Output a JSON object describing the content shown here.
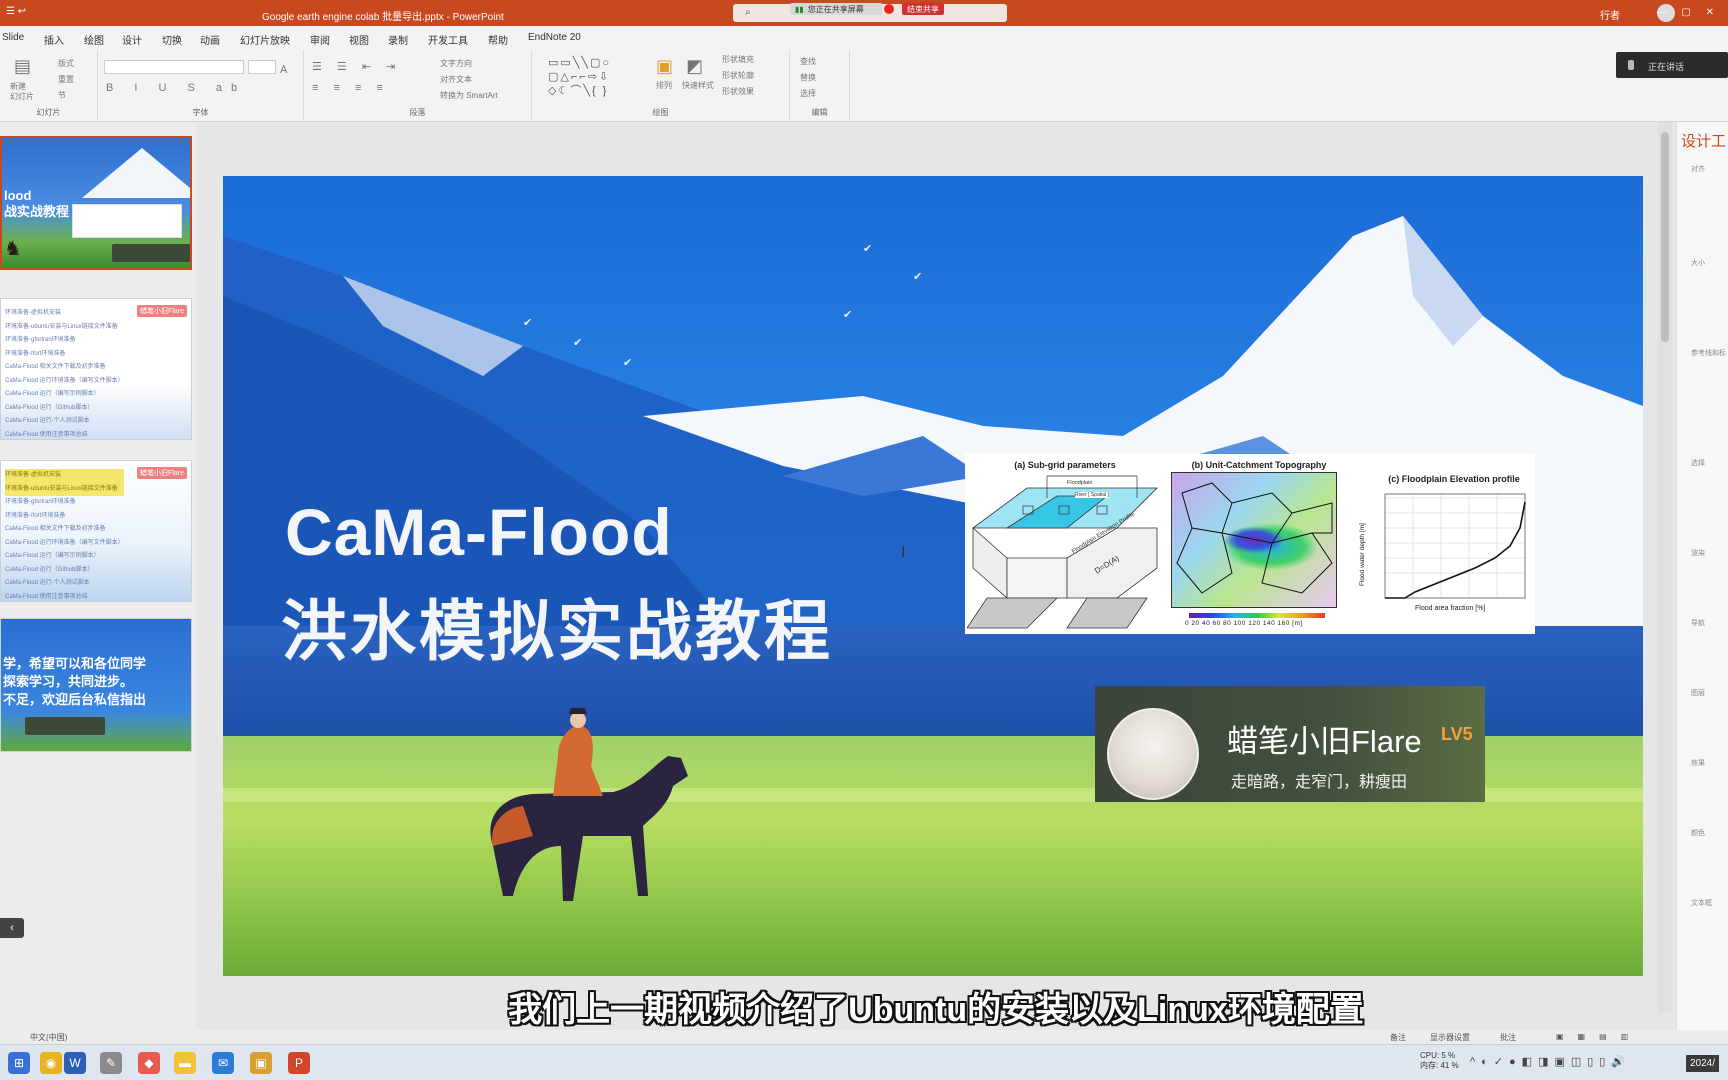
{
  "titlebar": {
    "file_title": "Google earth engine colab 批量导出.pptx  -  PowerPoint",
    "search_placeholder": "搜",
    "sharing_label": "您正在共享屏幕",
    "stop_share_label": "结束共享",
    "user_name": "行者",
    "window_controls": "— ▢ ✕"
  },
  "menubar": {
    "items": [
      "Slide",
      "插入",
      "绘图",
      "设计",
      "切换",
      "动画",
      "幻灯片放映",
      "审阅",
      "视图",
      "录制",
      "开发工具",
      "帮助",
      "EndNote 20"
    ]
  },
  "ribbon": {
    "groups": [
      "幻灯片",
      "字体",
      "段落",
      "绘图",
      "编辑"
    ],
    "new_slide": "新建\n幻灯片",
    "layout": "版式",
    "reset": "重置",
    "section": "节",
    "find": "查找",
    "replace": "替换",
    "select": "选择",
    "arrange": "排列",
    "quick_styles": "快速样式",
    "shape_fill": "形状填充",
    "shape_outline": "形状轮廓",
    "shape_effect": "形状效果",
    "text_direction": "文字方向",
    "align_text": "对齐文本",
    "smartart": "转换为 SmartArt",
    "present_label": "正在讲话"
  },
  "thumbnails": {
    "slide1_title": "lood\n战实战教程",
    "slide2_badge": "蜡笔小旧Flare",
    "slide2_lines": [
      "环境准备-虚拟机安装",
      "环境准备-ubuntu安装与Linux链接文件准备",
      "环境准备-gfortran环境准备",
      "环境准备-Ifort环境准备",
      "CaMa-Flood 相关文件下载及初步准备",
      "CaMa-Flood 运行环境准备（编写文件脚本）",
      "CaMa-Flood 运行（编写示例脚本）",
      "CaMa-Flood 运行（Github脚本）",
      "CaMa-Flood 运行-个人测试脚本",
      "CaMa-Flood 使用注意事项总结"
    ],
    "slide3_lines": [
      "环境准备-虚拟机安装",
      "环境准备-ubuntu安装与Linux链接文件准备",
      "环境准备-gfortran环境准备",
      "环境准备-Ifort环境准备",
      "CaMa-Flood 相关文件下载及初步准备",
      "CaMa-Flood 运行环境准备（编写文件脚本）",
      "CaMa-Flood 运行（编写示例脚本）",
      "CaMa-Flood 运行（Github脚本）",
      "CaMa-Flood 运行-个人测试脚本",
      "CaMa-Flood 使用注意事项总结"
    ],
    "slide4_text": "学，希望可以和各位同学\n探索学习，共同进步。\n不足，欢迎后台私信指出"
  },
  "slide": {
    "title_line1": "CaMa-Flood",
    "title_line2": "洪水模拟实战教程",
    "fig_a_title": "(a) Sub-grid parameters",
    "fig_b_title": "(b) Unit-Catchment Topography",
    "fig_c_title": "(c) Floodplain Elevation profile",
    "fig_b_colorbar_labels": "0   20   40   60   80  100 120 140 160  [m]",
    "fig_c_xlabel": "Flood area fraction [%]",
    "fig_c_ylabel": "Flood water depth [m]",
    "fig_a_labels": {
      "floodplain": "Floodplain",
      "river": "River [ Spatial ]",
      "profile": "Floodplain Elevation Profile",
      "formula": "D=D(A)"
    },
    "author_name": "蜡笔小旧Flare",
    "author_level": "LV5",
    "author_motto": "走暗路，走窄门，耕瘦田"
  },
  "subtitle": "我们上一期视频介绍了Ubuntu的安装以及Linux环境配置",
  "designpane": {
    "title": "设计工",
    "rows": [
      "对齐",
      "大小",
      "参考线和标",
      "选择",
      "渲染",
      "导航",
      "图层",
      "效果",
      "颜色",
      "文本框"
    ]
  },
  "statusbar": {
    "language": "中文(中国)",
    "notes": "备注",
    "display_settings": "显示器设置",
    "comments": "批注"
  },
  "taskbar": {
    "cpu": "CPU: 5 %",
    "mem": "内存: 41 %",
    "clock": "2024/"
  }
}
